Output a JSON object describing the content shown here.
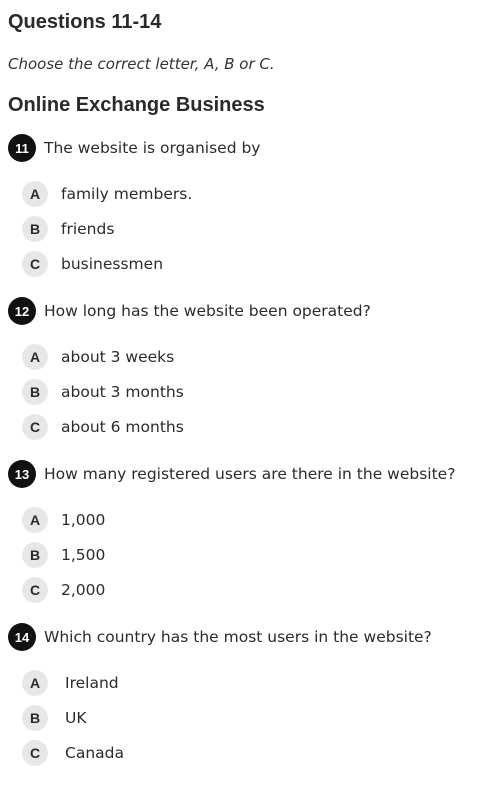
{
  "header": {
    "title": "Questions 11-14",
    "instructions_prefix": "Choose the correct letter, ",
    "instructions_a": "A",
    "instructions_sep1": ", ",
    "instructions_b": "B",
    "instructions_sep2": " or ",
    "instructions_c": "C",
    "instructions_suffix": "."
  },
  "subtitle": "Online Exchange Business",
  "questions": [
    {
      "number": "11",
      "text": "The website is organised by",
      "options": [
        {
          "letter": "A",
          "text": "family members."
        },
        {
          "letter": "B",
          "text": "friends"
        },
        {
          "letter": "C",
          "text": "businessmen"
        }
      ]
    },
    {
      "number": "12",
      "text": "How long has the website been operated?",
      "options": [
        {
          "letter": "A",
          "text": "about 3 weeks"
        },
        {
          "letter": "B",
          "text": "about 3 months"
        },
        {
          "letter": "C",
          "text": "about 6 months"
        }
      ]
    },
    {
      "number": "13",
      "text": "How many registered users are there in the website?",
      "options": [
        {
          "letter": "A",
          "text": "1,000"
        },
        {
          "letter": "B",
          "text": "1,500"
        },
        {
          "letter": "C",
          "text": "2,000"
        }
      ]
    },
    {
      "number": "14",
      "text": "Which country has the most users in the website?",
      "options": [
        {
          "letter": "A",
          "text": "Ireland"
        },
        {
          "letter": "B",
          "text": "UK"
        },
        {
          "letter": "C",
          "text": "Canada"
        }
      ]
    }
  ],
  "colors": {
    "number_badge": "#111111",
    "letter_badge": "#e7e7e7",
    "text": "#2b2b2b"
  }
}
